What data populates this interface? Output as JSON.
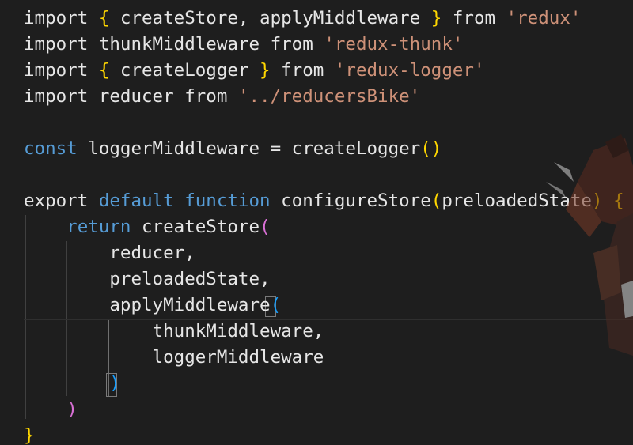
{
  "code": {
    "line1": {
      "kw": "import",
      "open": "{",
      "names": " createStore, applyMiddleware ",
      "close": "}",
      "from": "from",
      "module": "'redux'"
    },
    "line2": {
      "kw": "import",
      "name": "thunkMiddleware",
      "from": "from",
      "module": "'redux-thunk'"
    },
    "line3": {
      "kw": "import",
      "open": "{",
      "names": " createLogger ",
      "close": "}",
      "from": "from",
      "module": "'redux-logger'"
    },
    "line4": {
      "kw": "import",
      "name": "reducer",
      "from": "from",
      "module": "'../reducersBike'"
    },
    "line6": {
      "kw": "const",
      "name": "loggerMiddleware",
      "eq": "=",
      "fn": "createLogger",
      "parens": "()"
    },
    "line8": {
      "export": "export",
      "default": "default",
      "function": "function",
      "fn": "configureStore",
      "popen": "(",
      "param": "preloadedState",
      "pclose": ")",
      "brace": "{"
    },
    "line9": {
      "kw": "return",
      "fn": "createStore",
      "popen": "("
    },
    "line10": {
      "text": "reducer,"
    },
    "line11": {
      "text": "preloadedState,"
    },
    "line12": {
      "fn": "applyMiddleware",
      "popen": "("
    },
    "line13": {
      "text": "thunkMiddleware,"
    },
    "line14": {
      "text": "loggerMiddleware"
    },
    "line15": {
      "pclose": ")"
    },
    "line16": {
      "pclose": ")"
    },
    "line17": {
      "brace": "}"
    }
  },
  "colors": {
    "background": "#1e1e1e",
    "keyword_blue": "#569cd6",
    "keyword_pink": "#c586c0",
    "string": "#ce9178",
    "brace_gold": "#ffd700",
    "paren_pink": "#da70d6",
    "paren_blue": "#179fff"
  },
  "decor": {
    "mascot": "anime-character-watermark"
  }
}
